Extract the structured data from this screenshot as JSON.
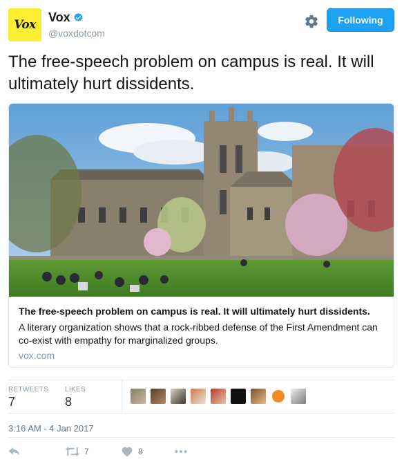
{
  "author": {
    "avatar_text": "Vox",
    "name": "Vox",
    "handle": "@voxdotcom",
    "follow_label": "Following"
  },
  "tweet": {
    "text": "The free-speech problem on campus is real. It will ultimately hurt dissidents.",
    "timestamp": "3:16 AM - 4 Jan 2017"
  },
  "card": {
    "title": "The free-speech problem on campus is real. It will ultimately hurt dissidents.",
    "description": "A literary organization shows that a rock-ribbed defense of the First Amendment can co-exist with empathy for marginalized groups.",
    "domain": "vox.com"
  },
  "stats": {
    "retweets_label": "RETWEETS",
    "retweets_value": "7",
    "likes_label": "LIKES",
    "likes_value": "8"
  },
  "actions": {
    "retweet_count": "7",
    "like_count": "8"
  },
  "colors": {
    "accent": "#1da1f2",
    "brand_yellow": "#fdee31",
    "muted": "#8899a6"
  }
}
